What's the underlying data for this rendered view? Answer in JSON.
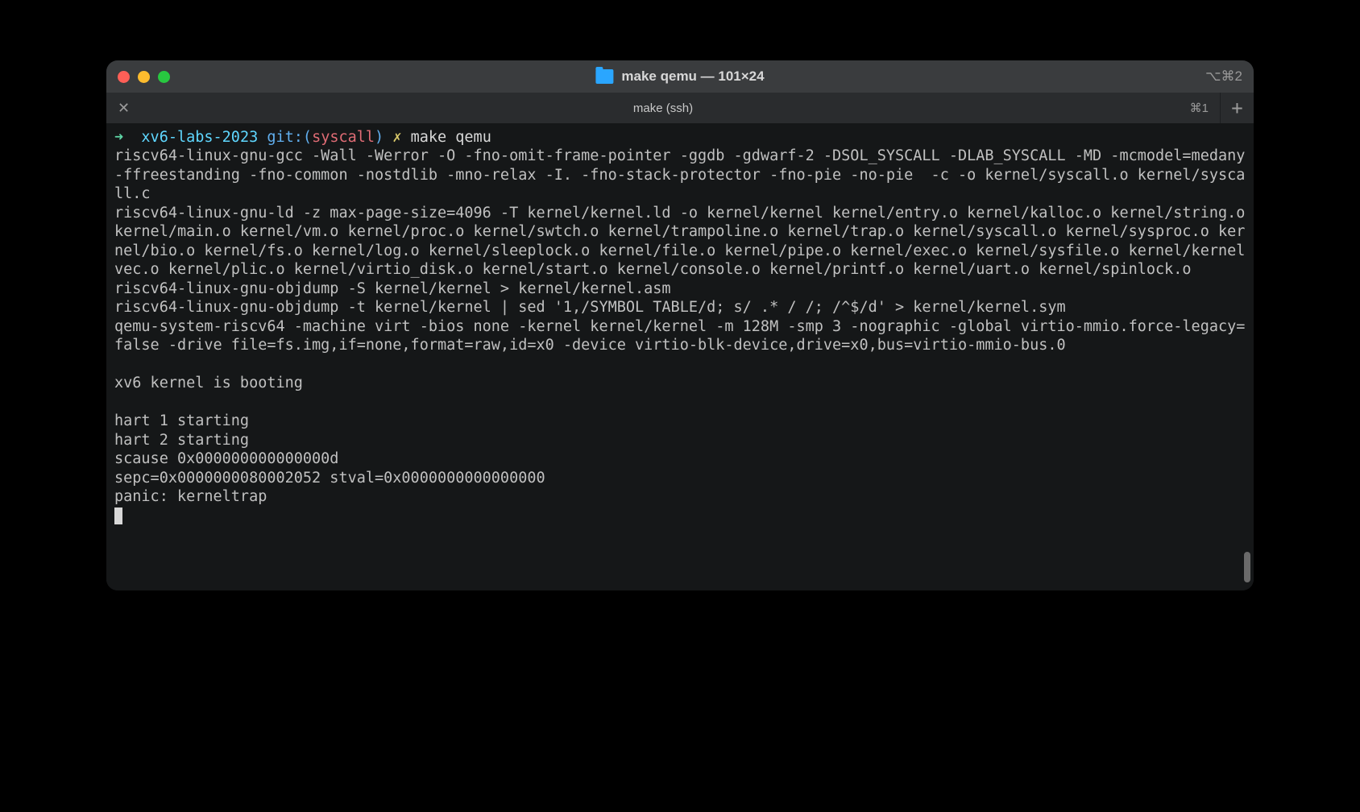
{
  "window": {
    "title": "make qemu — 101×24",
    "shortcut_right": "⌥⌘2"
  },
  "tab": {
    "label": "make (ssh)",
    "shortcut": "⌘1",
    "close_glyph": "✕",
    "add_glyph": "+"
  },
  "prompt": {
    "arrow": "➜",
    "path": "xv6-labs-2023",
    "git_label": "git:",
    "branch": "syscall",
    "x": "✗",
    "command": "make qemu"
  },
  "output_lines": [
    "riscv64-linux-gnu-gcc -Wall -Werror -O -fno-omit-frame-pointer -ggdb -gdwarf-2 -DSOL_SYSCALL -DLAB_SYSCALL -MD -mcmodel=medany -ffreestanding -fno-common -nostdlib -mno-relax -I. -fno-stack-protector -fno-pie -no-pie  -c -o kernel/syscall.o kernel/syscall.c",
    "riscv64-linux-gnu-ld -z max-page-size=4096 -T kernel/kernel.ld -o kernel/kernel kernel/entry.o kernel/kalloc.o kernel/string.o kernel/main.o kernel/vm.o kernel/proc.o kernel/swtch.o kernel/trampoline.o kernel/trap.o kernel/syscall.o kernel/sysproc.o kernel/bio.o kernel/fs.o kernel/log.o kernel/sleeplock.o kernel/file.o kernel/pipe.o kernel/exec.o kernel/sysfile.o kernel/kernelvec.o kernel/plic.o kernel/virtio_disk.o kernel/start.o kernel/console.o kernel/printf.o kernel/uart.o kernel/spinlock.o ",
    "riscv64-linux-gnu-objdump -S kernel/kernel > kernel/kernel.asm",
    "riscv64-linux-gnu-objdump -t kernel/kernel | sed '1,/SYMBOL TABLE/d; s/ .* / /; /^$/d' > kernel/kernel.sym",
    "qemu-system-riscv64 -machine virt -bios none -kernel kernel/kernel -m 128M -smp 3 -nographic -global virtio-mmio.force-legacy=false -drive file=fs.img,if=none,format=raw,id=x0 -device virtio-blk-device,drive=x0,bus=virtio-mmio-bus.0",
    "",
    "xv6 kernel is booting",
    "",
    "hart 1 starting",
    "hart 2 starting",
    "scause 0x000000000000000d",
    "sepc=0x0000000080002052 stval=0x0000000000000000",
    "panic: kerneltrap"
  ]
}
